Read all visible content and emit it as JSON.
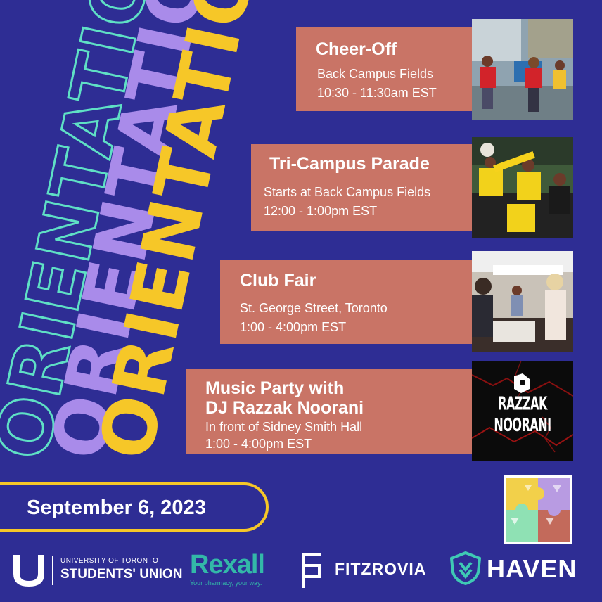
{
  "decor": {
    "word": "ORIENTATION",
    "colors": {
      "outline": "#5fe0c5",
      "purple": "#a98bea",
      "yellow": "#f6c728",
      "background": "#2e2d94",
      "card": "#c97466"
    }
  },
  "events": [
    {
      "title": "Cheer-Off",
      "location": "Back Campus Fields",
      "time": "10:30 - 11:30am EST"
    },
    {
      "title": "Tri-Campus Parade",
      "location": "Starts at Back Campus Fields",
      "time": "12:00 - 1:00pm  EST"
    },
    {
      "title": "Club Fair",
      "location": "St. George Street, Toronto",
      "time": "1:00 - 4:00pm EST"
    },
    {
      "title_line1": "Music Party with",
      "title_line2": "DJ Razzak Noorani",
      "location": "In front of Sidney Smith Hall",
      "time": "1:00 - 4:00pm EST"
    }
  ],
  "dj_logo_text": "RAZZAK NOORANI",
  "date": "September 6, 2023",
  "sponsors": {
    "utsu": {
      "line1": "UNIVERSITY OF TORONTO",
      "line2": "STUDENTS' UNION"
    },
    "rexall": {
      "name": "Rexall",
      "tagline": "Your pharmacy, your way."
    },
    "fitzrovia": {
      "name": "FITZROVIA"
    },
    "haven": {
      "name": "HAVEN"
    }
  }
}
